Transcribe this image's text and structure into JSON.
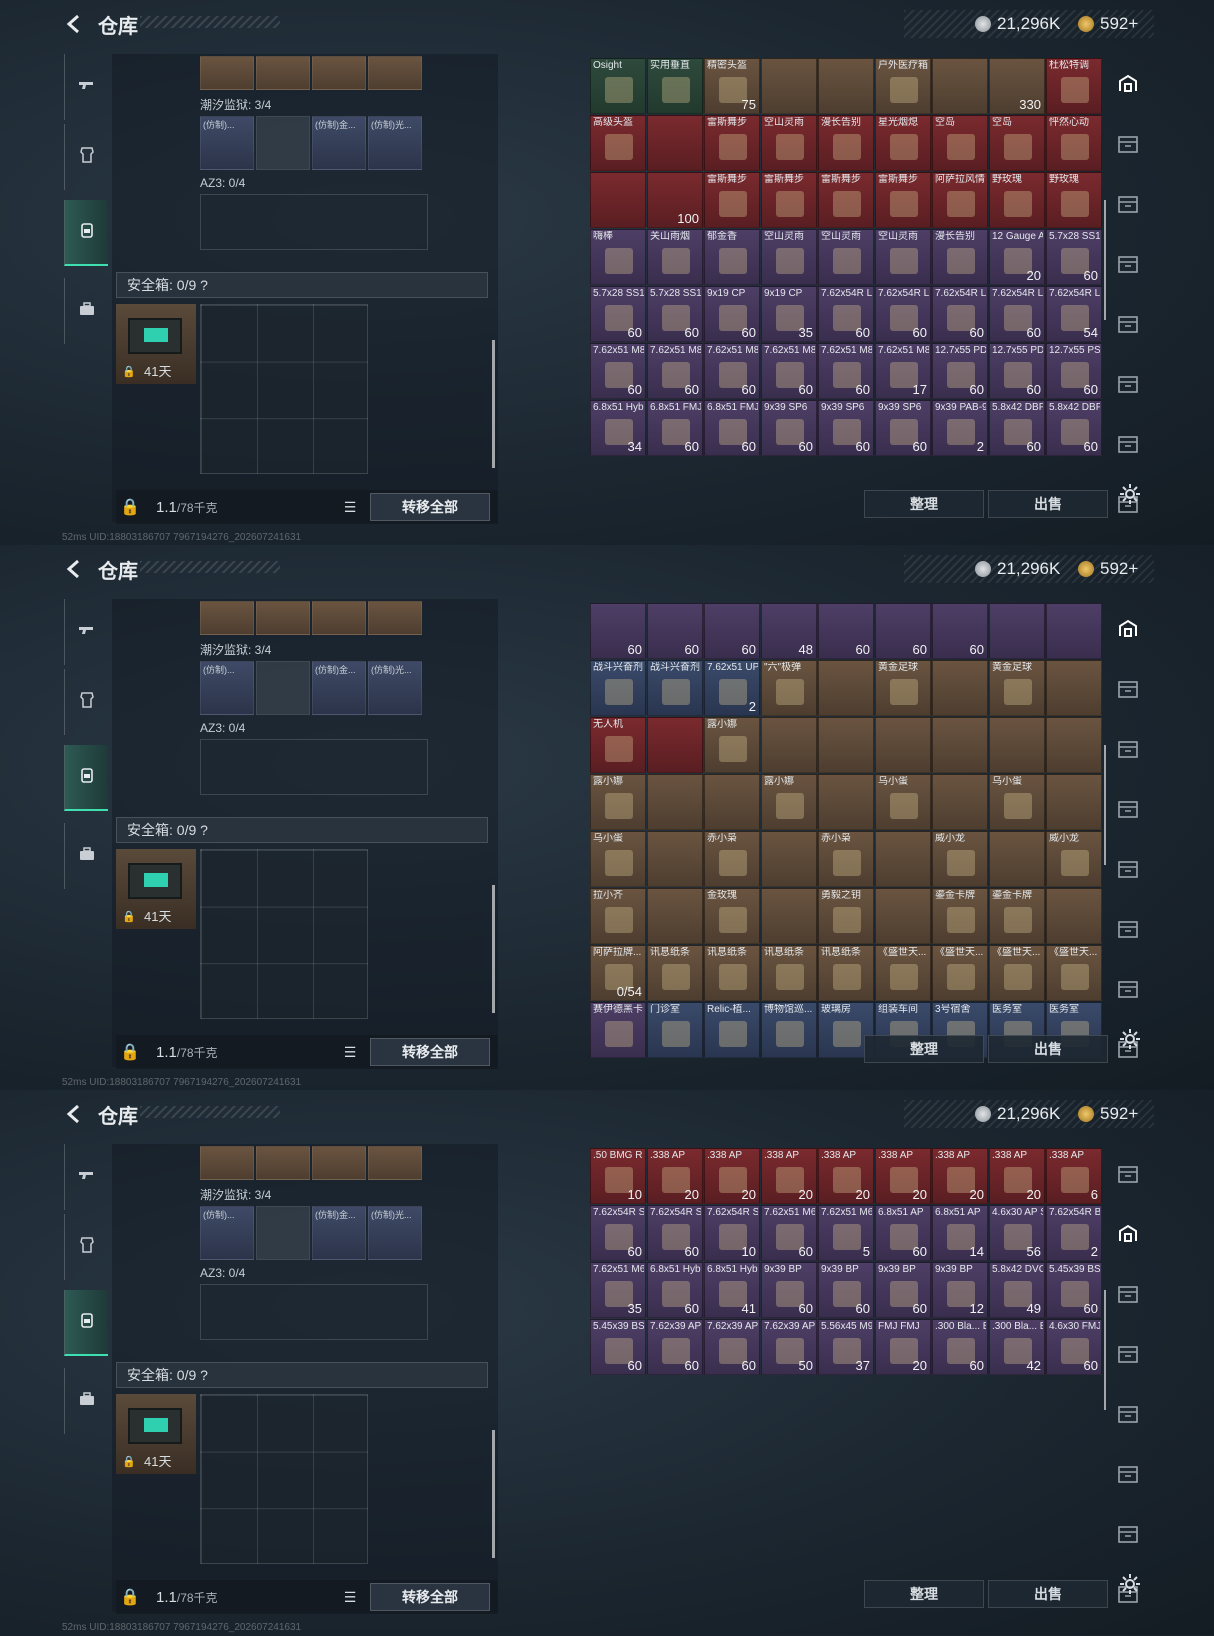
{
  "header": {
    "title": "仓库",
    "coins": "21,296K",
    "premium": "592+"
  },
  "left": {
    "container1_label": "潮汐监狱: 3/4",
    "container1_items": [
      "(仿制)...",
      "",
      "(仿制)金...",
      "(仿制)光..."
    ],
    "container2_label": "AZ3: 0/4",
    "safebox_label": "安全箱: 0/9 ?",
    "safebox_days": "41天",
    "weight_value": "1.1",
    "weight_max": "/78千克",
    "transfer_all": "转移全部"
  },
  "footer": "52ms   UID:18803186707 7967194276_202607241631",
  "panels": [
    {
      "rows": [
        [
          {
            "n": "Osight",
            "c": "c-green",
            "t": ""
          },
          {
            "n": "实用垂直",
            "c": "c-green",
            "t": ""
          },
          {
            "n": "精密头盔",
            "c": "c-brown",
            "t": "75"
          },
          {
            "n": "",
            "c": "c-brown",
            "t": ""
          },
          {
            "n": "",
            "c": "c-brown",
            "t": ""
          },
          {
            "n": "户外医疗箱",
            "c": "c-brown",
            "t": ""
          },
          {
            "n": "",
            "c": "c-brown",
            "t": ""
          },
          {
            "n": "",
            "c": "c-brown",
            "t": "330"
          },
          {
            "n": "杜松特调",
            "c": "c-red",
            "t": ""
          }
        ],
        [
          {
            "n": "高级头盔",
            "c": "c-red",
            "t": ""
          },
          {
            "n": "",
            "c": "c-red",
            "t": ""
          },
          {
            "n": "雷斯舞步",
            "c": "c-red",
            "t": ""
          },
          {
            "n": "空山灵雨",
            "c": "c-red",
            "t": ""
          },
          {
            "n": "漫长告别",
            "c": "c-red",
            "t": ""
          },
          {
            "n": "星光烟熄",
            "c": "c-red",
            "t": ""
          },
          {
            "n": "空岛",
            "c": "c-red",
            "t": ""
          },
          {
            "n": "空岛",
            "c": "c-red",
            "t": ""
          },
          {
            "n": "怦然心动",
            "c": "c-red",
            "t": ""
          }
        ],
        [
          {
            "n": "",
            "c": "c-red",
            "t": ""
          },
          {
            "n": "",
            "c": "c-red",
            "t": "100"
          },
          {
            "n": "雷斯舞步",
            "c": "c-red",
            "t": ""
          },
          {
            "n": "雷斯舞步",
            "c": "c-red",
            "t": ""
          },
          {
            "n": "雷斯舞步",
            "c": "c-red",
            "t": ""
          },
          {
            "n": "雷斯舞步",
            "c": "c-red",
            "t": ""
          },
          {
            "n": "阿萨拉风情",
            "c": "c-red",
            "t": ""
          },
          {
            "n": "野玫瑰",
            "c": "c-red",
            "t": ""
          },
          {
            "n": "野玫瑰",
            "c": "c-red",
            "t": ""
          }
        ],
        [
          {
            "n": "嗨棒",
            "c": "c-purple",
            "t": ""
          },
          {
            "n": "关山雨烟",
            "c": "c-purple",
            "t": ""
          },
          {
            "n": "郁金香",
            "c": "c-purple",
            "t": ""
          },
          {
            "n": "空山灵雨",
            "c": "c-purple",
            "t": ""
          },
          {
            "n": "空山灵雨",
            "c": "c-purple",
            "t": ""
          },
          {
            "n": "空山灵雨",
            "c": "c-purple",
            "t": ""
          },
          {
            "n": "漫长告别",
            "c": "c-purple",
            "t": ""
          },
          {
            "n": "12 Gauge AP",
            "c": "c-purple",
            "t": "20"
          },
          {
            "n": "5.7x28 SS190",
            "c": "c-purple",
            "t": "60"
          }
        ],
        [
          {
            "n": "5.7x28 SS190",
            "c": "c-purple",
            "t": "60"
          },
          {
            "n": "5.7x28 SS190",
            "c": "c-purple",
            "t": "60"
          },
          {
            "n": "9x19 CP",
            "c": "c-purple",
            "t": "60"
          },
          {
            "n": "9x19 CP",
            "c": "c-purple",
            "t": "35"
          },
          {
            "n": "7.62x54R LPS",
            "c": "c-purple",
            "t": "60"
          },
          {
            "n": "7.62x54R LPS",
            "c": "c-purple",
            "t": "60"
          },
          {
            "n": "7.62x54R LPS",
            "c": "c-purple",
            "t": "60"
          },
          {
            "n": "7.62x54R LPS",
            "c": "c-purple",
            "t": "60"
          },
          {
            "n": "7.62x54R LPS",
            "c": "c-purple",
            "t": "54"
          }
        ],
        [
          {
            "n": "7.62x51 M80",
            "c": "c-purple",
            "t": "60"
          },
          {
            "n": "7.62x51 M80",
            "c": "c-purple",
            "t": "60"
          },
          {
            "n": "7.62x51 M80",
            "c": "c-purple",
            "t": "60"
          },
          {
            "n": "7.62x51 M80",
            "c": "c-purple",
            "t": "60"
          },
          {
            "n": "7.62x51 M80",
            "c": "c-purple",
            "t": "60"
          },
          {
            "n": "7.62x51 M80",
            "c": "c-purple",
            "t": "17"
          },
          {
            "n": "12.7x55 PD12双头",
            "c": "c-purple",
            "t": "60"
          },
          {
            "n": "12.7x55 PD12双头",
            "c": "c-purple",
            "t": "60"
          },
          {
            "n": "12.7x55 PS12",
            "c": "c-purple",
            "t": "60"
          }
        ],
        [
          {
            "n": "6.8x51 Hybrid",
            "c": "c-purple",
            "t": "34"
          },
          {
            "n": "6.8x51 FMJ",
            "c": "c-purple",
            "t": "60"
          },
          {
            "n": "6.8x51 FMJ",
            "c": "c-purple",
            "t": "60"
          },
          {
            "n": "9x39 SP6",
            "c": "c-purple",
            "t": "60"
          },
          {
            "n": "9x39 SP6",
            "c": "c-purple",
            "t": "60"
          },
          {
            "n": "9x39 SP6",
            "c": "c-purple",
            "t": "60"
          },
          {
            "n": "9x39 PAB-9",
            "c": "c-purple",
            "t": "2"
          },
          {
            "n": "5.8x42 DBP10+P",
            "c": "c-purple",
            "t": "60"
          },
          {
            "n": "5.8x42 DBP10",
            "c": "c-purple",
            "t": "60"
          }
        ]
      ],
      "btn_sort": "整理",
      "btn_sell": "出售"
    },
    {
      "rows": [
        [
          {
            "n": "",
            "c": "c-purple",
            "t": "60"
          },
          {
            "n": "",
            "c": "c-purple",
            "t": "60"
          },
          {
            "n": "",
            "c": "c-purple",
            "t": "60"
          },
          {
            "n": "",
            "c": "c-purple",
            "t": "48"
          },
          {
            "n": "",
            "c": "c-purple",
            "t": "60"
          },
          {
            "n": "",
            "c": "c-purple",
            "t": "60"
          },
          {
            "n": "",
            "c": "c-purple",
            "t": "60"
          },
          {
            "n": "",
            "c": "c-purple",
            "t": ""
          },
          {
            "n": "",
            "c": "c-purple",
            "t": ""
          }
        ],
        [
          {
            "n": "战斗兴奋剂",
            "c": "c-blue",
            "t": ""
          },
          {
            "n": "战斗兴奋剂",
            "c": "c-blue",
            "t": ""
          },
          {
            "n": "7.62x51 UPS",
            "c": "c-blue",
            "t": "2"
          },
          {
            "n": "\"六\"极弹",
            "c": "c-brown",
            "t": ""
          },
          {
            "n": "",
            "c": "c-brown",
            "t": ""
          },
          {
            "n": "黄金足球",
            "c": "c-brown",
            "t": ""
          },
          {
            "n": "",
            "c": "c-brown",
            "t": ""
          },
          {
            "n": "黄金足球",
            "c": "c-brown",
            "t": ""
          },
          {
            "n": "",
            "c": "c-brown",
            "t": ""
          }
        ],
        [
          {
            "n": "无人机",
            "c": "c-red",
            "t": ""
          },
          {
            "n": "",
            "c": "c-red",
            "t": ""
          },
          {
            "n": "露小娜",
            "c": "c-brown",
            "t": ""
          },
          {
            "n": "",
            "c": "c-brown",
            "t": ""
          },
          {
            "n": "",
            "c": "c-brown",
            "t": ""
          },
          {
            "n": "",
            "c": "c-brown",
            "t": ""
          },
          {
            "n": "",
            "c": "c-brown",
            "t": ""
          },
          {
            "n": "",
            "c": "c-brown",
            "t": ""
          },
          {
            "n": "",
            "c": "c-brown",
            "t": ""
          }
        ],
        [
          {
            "n": "露小娜",
            "c": "c-brown",
            "t": ""
          },
          {
            "n": "",
            "c": "c-brown",
            "t": ""
          },
          {
            "n": "",
            "c": "c-brown",
            "t": ""
          },
          {
            "n": "露小娜",
            "c": "c-brown",
            "t": ""
          },
          {
            "n": "",
            "c": "c-brown",
            "t": ""
          },
          {
            "n": "乌小蛋",
            "c": "c-brown",
            "t": ""
          },
          {
            "n": "",
            "c": "c-brown",
            "t": ""
          },
          {
            "n": "乌小蛋",
            "c": "c-brown",
            "t": ""
          },
          {
            "n": "",
            "c": "c-brown",
            "t": ""
          }
        ],
        [
          {
            "n": "乌小蛋",
            "c": "c-brown",
            "t": ""
          },
          {
            "n": "",
            "c": "c-brown",
            "t": ""
          },
          {
            "n": "赤小枭",
            "c": "c-brown",
            "t": ""
          },
          {
            "n": "",
            "c": "c-brown",
            "t": ""
          },
          {
            "n": "赤小枭",
            "c": "c-brown",
            "t": ""
          },
          {
            "n": "",
            "c": "c-brown",
            "t": ""
          },
          {
            "n": "威小龙",
            "c": "c-brown",
            "t": ""
          },
          {
            "n": "",
            "c": "c-brown",
            "t": ""
          },
          {
            "n": "威小龙",
            "c": "c-brown",
            "t": ""
          }
        ],
        [
          {
            "n": "拉小齐",
            "c": "c-brown",
            "t": ""
          },
          {
            "n": "",
            "c": "c-brown",
            "t": ""
          },
          {
            "n": "金玫瑰",
            "c": "c-brown",
            "t": ""
          },
          {
            "n": "",
            "c": "c-brown",
            "t": ""
          },
          {
            "n": "勇毅之钥",
            "c": "c-brown",
            "t": ""
          },
          {
            "n": "",
            "c": "c-brown",
            "t": ""
          },
          {
            "n": "鎏金卡牌",
            "c": "c-brown",
            "t": ""
          },
          {
            "n": "鎏金卡牌",
            "c": "c-brown",
            "t": ""
          },
          {
            "n": "",
            "c": "c-brown",
            "t": ""
          }
        ],
        [
          {
            "n": "阿萨拉牌...",
            "c": "c-brown",
            "t": "0/54"
          },
          {
            "n": "讯息纸条",
            "c": "c-brown",
            "t": ""
          },
          {
            "n": "讯息纸条",
            "c": "c-brown",
            "t": ""
          },
          {
            "n": "讯息纸条",
            "c": "c-brown",
            "t": ""
          },
          {
            "n": "讯息纸条",
            "c": "c-brown",
            "t": ""
          },
          {
            "n": "《盛世天...",
            "c": "c-brown",
            "t": ""
          },
          {
            "n": "《盛世天...",
            "c": "c-brown",
            "t": ""
          },
          {
            "n": "《盛世天...",
            "c": "c-brown",
            "t": ""
          },
          {
            "n": "《盛世天...",
            "c": "c-brown",
            "t": ""
          }
        ],
        [
          {
            "n": "赛伊德黑卡",
            "c": "c-purple",
            "t": ""
          },
          {
            "n": "门诊室",
            "c": "c-blue",
            "t": ""
          },
          {
            "n": "Relic-植...",
            "c": "c-blue",
            "t": ""
          },
          {
            "n": "博物馆巡...",
            "c": "c-blue",
            "t": ""
          },
          {
            "n": "玻璃房",
            "c": "c-blue",
            "t": ""
          },
          {
            "n": "组装车间",
            "c": "c-blue",
            "t": ""
          },
          {
            "n": "3号宿舍",
            "c": "c-blue",
            "t": ""
          },
          {
            "n": "医务室",
            "c": "c-blue",
            "t": ""
          },
          {
            "n": "医务室",
            "c": "c-blue",
            "t": ""
          }
        ]
      ],
      "btn_sort": "整理",
      "btn_sell": "出售"
    },
    {
      "rows": [
        [
          {
            "n": ".50 BMG R",
            "c": "c-red",
            "t": "10"
          },
          {
            "n": ".338 AP",
            "c": "c-red",
            "t": "20"
          },
          {
            "n": ".338 AP",
            "c": "c-red",
            "t": "20"
          },
          {
            "n": ".338 AP",
            "c": "c-red",
            "t": "20"
          },
          {
            "n": ".338 AP",
            "c": "c-red",
            "t": "20"
          },
          {
            "n": ".338 AP",
            "c": "c-red",
            "t": "20"
          },
          {
            "n": ".338 AP",
            "c": "c-red",
            "t": "20"
          },
          {
            "n": ".338 AP",
            "c": "c-red",
            "t": "20"
          },
          {
            "n": ".338 AP",
            "c": "c-red",
            "t": "6"
          }
        ],
        [
          {
            "n": "7.62x54R SNB",
            "c": "c-purple",
            "t": "60"
          },
          {
            "n": "7.62x54R SNB",
            "c": "c-purple",
            "t": "60"
          },
          {
            "n": "7.62x54R SNB",
            "c": "c-purple",
            "t": "10"
          },
          {
            "n": "7.62x51 M62",
            "c": "c-purple",
            "t": "60"
          },
          {
            "n": "7.62x51 M62",
            "c": "c-purple",
            "t": "5"
          },
          {
            "n": "6.8x51 AP",
            "c": "c-purple",
            "t": "60"
          },
          {
            "n": "6.8x51 AP",
            "c": "c-purple",
            "t": "14"
          },
          {
            "n": "4.6x30 AP SX",
            "c": "c-purple",
            "t": "56"
          },
          {
            "n": "7.62x54R BT",
            "c": "c-purple",
            "t": "2"
          }
        ],
        [
          {
            "n": "7.62x51 M62",
            "c": "c-purple",
            "t": "35"
          },
          {
            "n": "6.8x51 Hybrid",
            "c": "c-purple",
            "t": "60"
          },
          {
            "n": "6.8x51 Hybrid",
            "c": "c-purple",
            "t": "41"
          },
          {
            "n": "9x39 BP",
            "c": "c-purple",
            "t": "60"
          },
          {
            "n": "9x39 BP",
            "c": "c-purple",
            "t": "60"
          },
          {
            "n": "9x39 BP",
            "c": "c-purple",
            "t": "60"
          },
          {
            "n": "9x39 BP",
            "c": "c-purple",
            "t": "12"
          },
          {
            "n": "5.8x42 DVC12",
            "c": "c-purple",
            "t": "49"
          },
          {
            "n": "5.45x39 BS",
            "c": "c-purple",
            "t": "60"
          }
        ],
        [
          {
            "n": "5.45x39 BS",
            "c": "c-purple",
            "t": "60"
          },
          {
            "n": "7.62x39 AP",
            "c": "c-purple",
            "t": "60"
          },
          {
            "n": "7.62x39 AP",
            "c": "c-purple",
            "t": "60"
          },
          {
            "n": "7.62x39 AP",
            "c": "c-purple",
            "t": "50"
          },
          {
            "n": "5.56x45 M995",
            "c": "c-purple",
            "t": "37"
          },
          {
            "n": "FMJ FMJ",
            "c": "c-purple",
            "t": "20"
          },
          {
            "n": ".300 Bla... BCP FMJ",
            "c": "c-purple",
            "t": "60"
          },
          {
            "n": ".300 Bla... BCP FMJ",
            "c": "c-purple",
            "t": "42"
          },
          {
            "n": "4.6x30 FMJ SX",
            "c": "c-purple",
            "t": "60"
          }
        ]
      ],
      "btn_sort": "整理",
      "btn_sell": "出售"
    }
  ],
  "colors": {
    "accent": "#3fe0b0",
    "coin_silver": "#c0c4c8",
    "coin_gold": "#d4a24a"
  }
}
